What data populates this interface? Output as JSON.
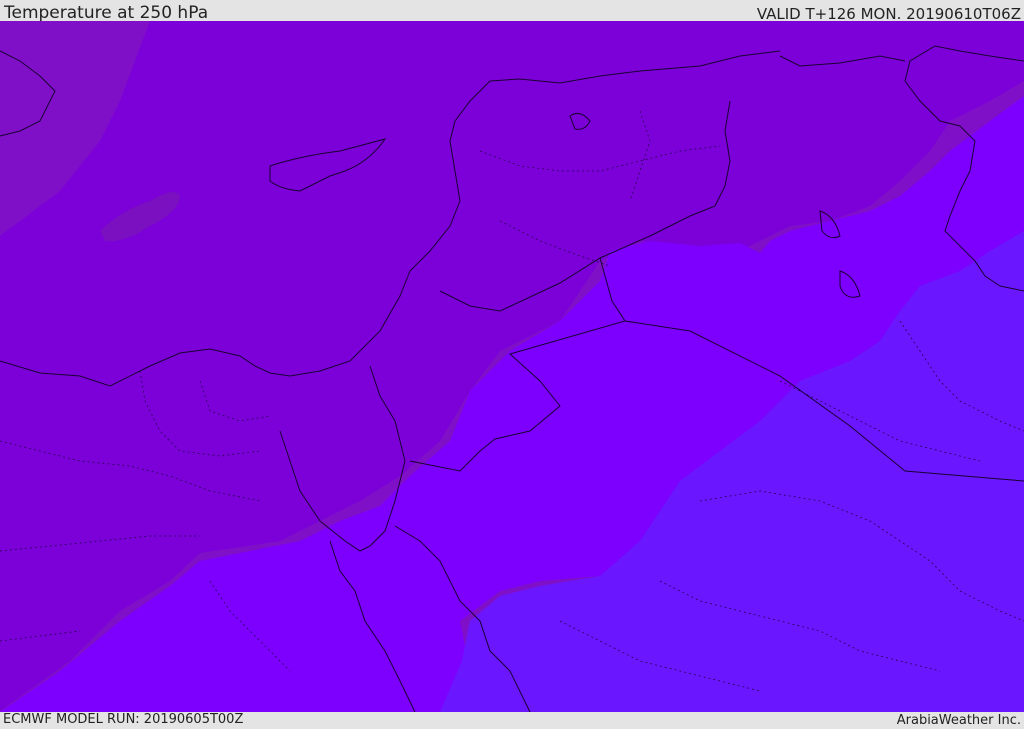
{
  "header": {
    "title": "Temperature at 250 hPa",
    "valid": "VALID T+126 MON. 20190610T06Z"
  },
  "footer": {
    "model_run": "ECMWF MODEL RUN: 20190605T00Z",
    "credit": "ArabiaWeather Inc."
  },
  "colors": {
    "frame": "#e4e4e4",
    "band_coldest": "#7f10c8",
    "band_cold": "#7c00d8",
    "band_mid": "#7d00ff",
    "band_warm": "#6a17ff",
    "coastline": "#1a0033"
  }
}
